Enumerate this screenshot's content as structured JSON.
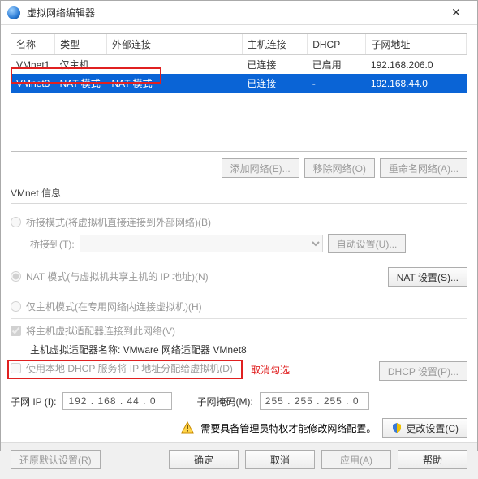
{
  "window": {
    "title": "虚拟网络编辑器"
  },
  "columns": {
    "name": "名称",
    "type": "类型",
    "ext": "外部连接",
    "host": "主机连接",
    "dhcp": "DHCP",
    "subnet": "子网地址"
  },
  "rows": [
    {
      "name": "VMnet1",
      "type": "仅主机",
      "ext": "",
      "host": "已连接",
      "dhcp": "已启用",
      "subnet": "192.168.206.0"
    },
    {
      "name": "VMnet8",
      "type": "NAT 模式",
      "ext": "NAT 模式",
      "host": "已连接",
      "dhcp": "-",
      "subnet": "192.168.44.0"
    }
  ],
  "actions": {
    "add": "添加网络(E)...",
    "remove": "移除网络(O)",
    "rename": "重命名网络(A)..."
  },
  "group": {
    "title": "VMnet 信息",
    "bridged": "桥接模式(将虚拟机直接连接到外部网络)(B)",
    "bridged_to_label": "桥接到(T):",
    "auto_btn": "自动设置(U)...",
    "nat": "NAT 模式(与虚拟机共享主机的 IP 地址)(N)",
    "nat_btn": "NAT 设置(S)...",
    "hostonly": "仅主机模式(在专用网络内连接虚拟机)(H)",
    "connect_host": "将主机虚拟适配器连接到此网络(V)",
    "adapter_label": "主机虚拟适配器名称: ",
    "adapter_name": "VMware 网络适配器 VMnet8",
    "dhcp_chk": "使用本地 DHCP 服务将 IP 地址分配给虚拟机(D)",
    "dhcp_btn": "DHCP 设置(P)...",
    "annot": "取消勾选",
    "subnet_ip_label": "子网 IP (I):",
    "subnet_ip": "192 . 168 .  44 .  0",
    "mask_label": "子网掩码(M):",
    "mask": "255 . 255 . 255 .  0"
  },
  "warnbar": {
    "text": "需要具备管理员特权才能修改网络配置。",
    "change": "更改设置(C)"
  },
  "footer": {
    "restore": "还原默认设置(R)",
    "ok": "确定",
    "cancel": "取消",
    "apply": "应用(A)",
    "help": "帮助"
  }
}
